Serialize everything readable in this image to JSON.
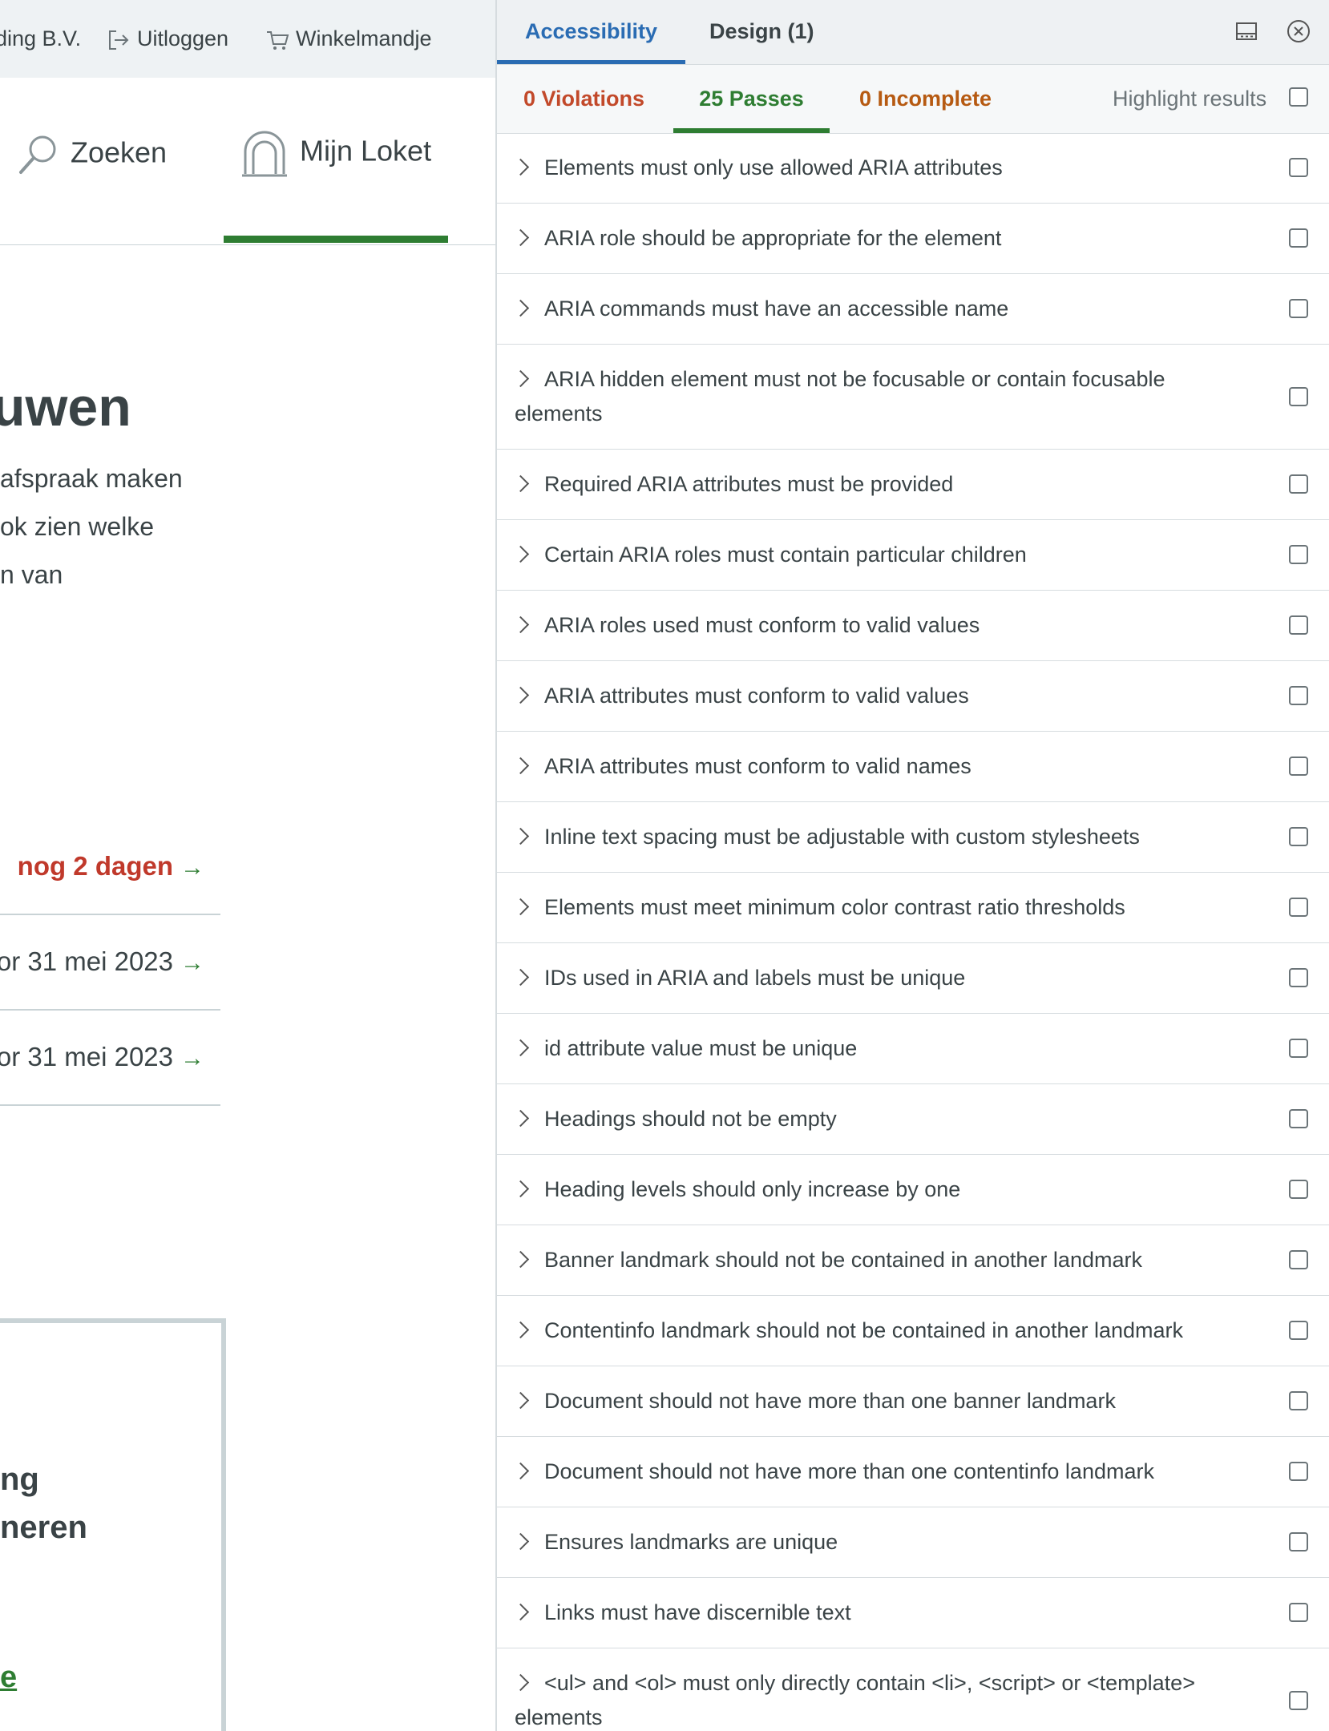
{
  "site": {
    "topbar": {
      "company": "ding B.V.",
      "logout": "Uitloggen",
      "cart": "Winkelmandje"
    },
    "nav": {
      "search": "Zoeken",
      "account": "Mijn Loket"
    },
    "hero": {
      "title": "uwen",
      "lines": [
        "afspraak maken",
        "ok zien welke",
        "n van"
      ]
    },
    "links": [
      {
        "text": "nog 2 dagen",
        "color": "#c0392b"
      },
      {
        "text": "or 31 mei 2023",
        "color": "#3a4346"
      },
      {
        "text": "or 31 mei 2023",
        "color": "#3a4346"
      }
    ],
    "card": {
      "lines": [
        "ng",
        "neren"
      ],
      "link": "e"
    }
  },
  "panel": {
    "tabs": [
      "Accessibility",
      "Design (1)"
    ],
    "icons": [
      "dock-icon",
      "close-icon"
    ],
    "filters": {
      "violations": "0 Violations",
      "passes": "25 Passes",
      "incomplete": "0 Incomplete",
      "highlight": "Highlight results"
    },
    "results": [
      "Elements must only use allowed ARIA attributes",
      "ARIA role should be appropriate for the element",
      "ARIA commands must have an accessible name",
      "ARIA hidden element must not be focusable or contain focusable elements",
      "Required ARIA attributes must be provided",
      "Certain ARIA roles must contain particular children",
      "ARIA roles used must conform to valid values",
      "ARIA attributes must conform to valid values",
      "ARIA attributes must conform to valid names",
      "Inline text spacing must be adjustable with custom stylesheets",
      "Elements must meet minimum color contrast ratio thresholds",
      "IDs used in ARIA and labels must be unique",
      "id attribute value must be unique",
      "Headings should not be empty",
      "Heading levels should only increase by one",
      "Banner landmark should not be contained in another landmark",
      "Contentinfo landmark should not be contained in another landmark",
      "Document should not have more than one banner landmark",
      "Document should not have more than one contentinfo landmark",
      "Ensures landmarks are unique",
      "Links must have discernible text",
      "<ul> and <ol> must only directly contain <li>, <script> or <template> elements"
    ]
  }
}
